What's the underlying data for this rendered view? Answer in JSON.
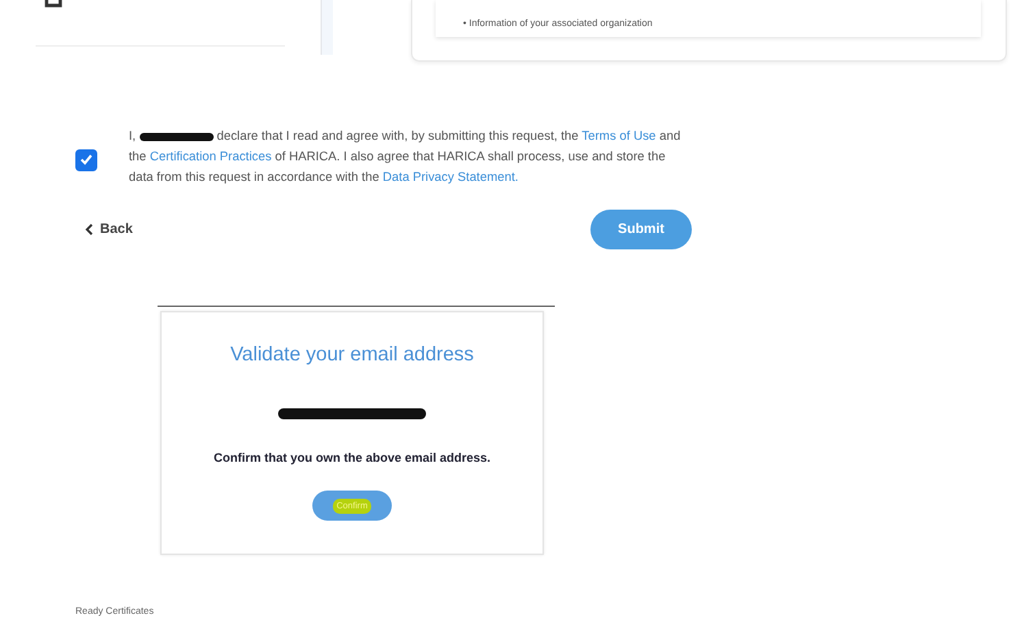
{
  "top_card": {
    "bullet": "• Information of your associated organization"
  },
  "agreement": {
    "checked": true,
    "parts": [
      {
        "kind": "text",
        "text": "I,"
      },
      {
        "kind": "redacted"
      },
      {
        "kind": "text",
        "text": "declare that I read and agree with, by submitting this request, the"
      },
      {
        "kind": "link",
        "text": "Terms of Use"
      },
      {
        "kind": "text",
        "text": "and the"
      },
      {
        "kind": "link",
        "text": "Certification Practices"
      },
      {
        "kind": "text",
        "text": "of HARICA. I also agree that HARICA shall process, use and store the data from this request in accordance with the"
      },
      {
        "kind": "link",
        "text": "Data Privacy Statement."
      }
    ]
  },
  "back": {
    "label": "Back"
  },
  "submit": {
    "label": "Submit"
  },
  "validate": {
    "title": "Validate your email address",
    "email_redacted": true,
    "message": "Confirm that you own the above email address.",
    "button": "Confirm",
    "highlighted": true
  },
  "footer": {
    "label": "Ready Certificates"
  }
}
